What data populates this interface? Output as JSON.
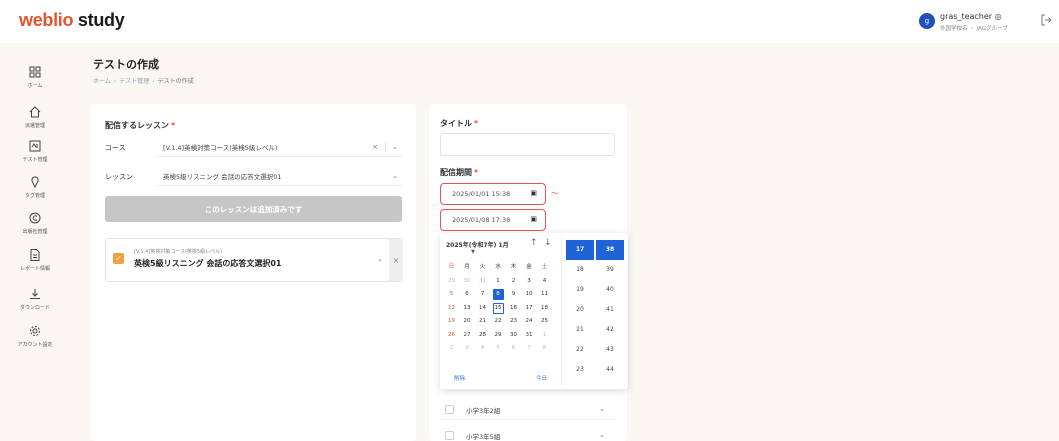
{
  "header": {
    "logo_main": "weblio",
    "logo_rest": " study",
    "user_initial": "g",
    "user_name": "gras_teacher ◎",
    "user_sub": "外国学校名 ・ JAGグループ"
  },
  "sidebar": {
    "items": [
      {
        "label": "ホーム",
        "icon": "grid-icon"
      },
      {
        "label": "派遣管理",
        "icon": "home-icon"
      },
      {
        "label": "テスト管理",
        "icon": "test-icon"
      },
      {
        "label": "タグ管理",
        "icon": "tag-icon"
      },
      {
        "label": "出版社管理",
        "icon": "copyright-icon"
      },
      {
        "label": "レポート情報",
        "icon": "report-icon"
      },
      {
        "label": "ダウンロード",
        "icon": "download-icon"
      },
      {
        "label": "アカウント設定",
        "icon": "settings-icon"
      }
    ]
  },
  "page": {
    "title": "テストの作成",
    "breadcrumb": [
      "ホーム",
      "テスト管理",
      "テストの作成"
    ]
  },
  "lesson_panel": {
    "heading": "配信するレッスン",
    "course_label": "コース",
    "course_value": "[V.1.4]英検対策コース(英検5級レベル)",
    "lesson_label": "レッスン",
    "lesson_value": "英検5級リスニング 会話の応答文選択01",
    "add_button": "このレッスンは追加済みです",
    "added_lesson_sub": "[V.1.4]英検対策コース(英検5級レベル)",
    "added_lesson_title": "英検5級リスニング 会話の応答文選択01"
  },
  "form": {
    "title_label": "タイトル",
    "period_label": "配信期間",
    "start_date": "2025/01/01 15:38",
    "end_date": "2025/01/08 17:38",
    "tilde": "〜",
    "grades": [
      "小学3年2組",
      "小学3年5組"
    ]
  },
  "picker": {
    "header": "2025年(令和7年) 1月",
    "weekdays": [
      "日",
      "月",
      "火",
      "水",
      "木",
      "金",
      "土"
    ],
    "weeks": [
      [
        29,
        30,
        31,
        1,
        2,
        3,
        4
      ],
      [
        5,
        6,
        7,
        8,
        9,
        10,
        11
      ],
      [
        12,
        13,
        14,
        15,
        16,
        17,
        18
      ],
      [
        19,
        20,
        21,
        22,
        23,
        24,
        25
      ],
      [
        26,
        27,
        28,
        29,
        30,
        31,
        1
      ],
      [
        2,
        3,
        4,
        5,
        6,
        7,
        8
      ]
    ],
    "selected_day": 8,
    "today_day": 15,
    "hours": [
      "17",
      "18",
      "19",
      "20",
      "21",
      "22",
      "23"
    ],
    "minutes": [
      "38",
      "39",
      "40",
      "41",
      "42",
      "43",
      "44"
    ],
    "foot_left": "削除",
    "foot_right": "今日",
    "colors": {
      "accent": "#1f63d6",
      "error": "#e35454",
      "brand": "#e6522c"
    }
  }
}
